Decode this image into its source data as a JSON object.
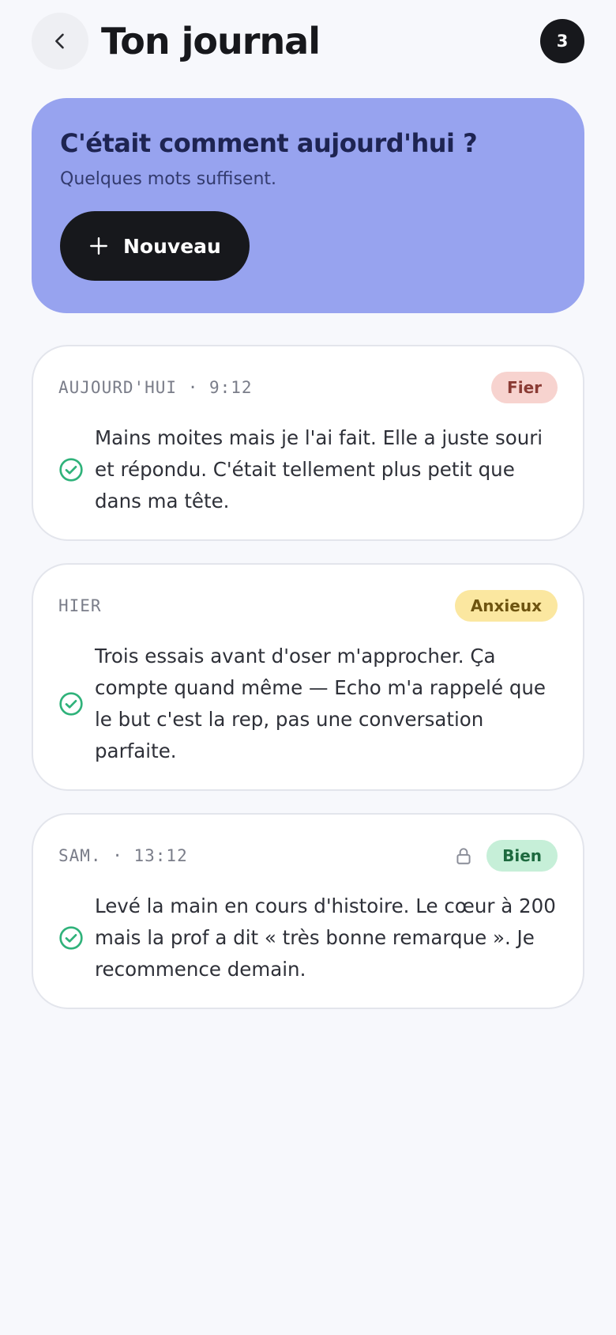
{
  "header": {
    "title": "Ton journal",
    "entry_count": "3",
    "back_icon": "chevron-left-icon"
  },
  "prompt": {
    "title": "C'était comment aujourd'hui ?",
    "subtitle": "Quelques mots suffisent.",
    "new_button_label": "Nouveau",
    "background_color": "#97a3ef"
  },
  "entries": [
    {
      "date": "AUJOURD'HUI · 9:12",
      "mood": "Fier",
      "mood_bg": "#f7d3cf",
      "mood_color": "#8a3b34",
      "locked": false,
      "text": "Mains moites mais je l'ai fait. Elle a juste souri et répondu. C'était tellement plus petit que dans ma tête."
    },
    {
      "date": "HIER",
      "mood": "Anxieux",
      "mood_bg": "#fbe7a0",
      "mood_color": "#6e5410",
      "locked": false,
      "text": "Trois essais avant d'oser m'approcher. Ça compte quand même — Echo m'a rappelé que le but c'est la rep, pas une conversation parfaite."
    },
    {
      "date": "SAM. · 13:12",
      "mood": "Bien",
      "mood_bg": "#c6efd8",
      "mood_color": "#1d6a3f",
      "locked": true,
      "text": "Levé la main en cours d'histoire. Le cœur à 200 mais la prof a dit « très bonne remarque ». Je recommence demain."
    }
  ],
  "colors": {
    "accent_dark": "#17181c",
    "check_green": "#2fb27a",
    "page_bg": "#f7f8fc"
  }
}
